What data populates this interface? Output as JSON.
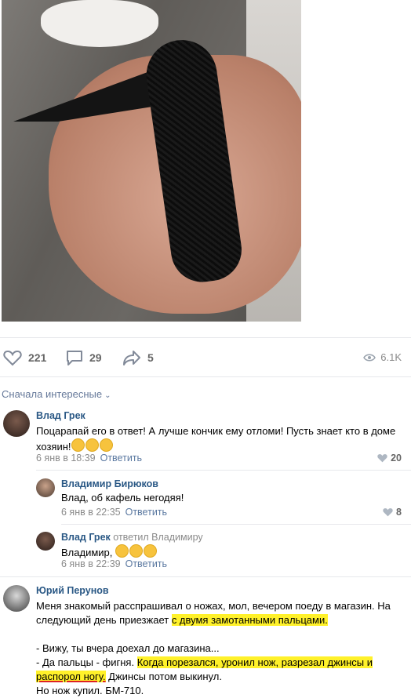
{
  "post": {
    "image_alt": "photo",
    "likes": "221",
    "comments": "29",
    "shares": "5",
    "views": "6.1K"
  },
  "sort_label": "Сначала интересные",
  "comments": [
    {
      "author": "Влад Грек",
      "text": "Поцарапай его в ответ! А лучше кончик ему отломи! Пусть знает кто в доме хозяин!",
      "emoji_count": 3,
      "date": "6 янв в 18:39",
      "reply_label": "Ответить",
      "likes": "20",
      "replies": [
        {
          "author": "Владимир Бирюков",
          "text": "Влад, об кафель негодяя!",
          "date": "6 янв в 22:35",
          "reply_label": "Ответить",
          "likes": "8"
        },
        {
          "author": "Влад Грек",
          "reply_to": "ответил Владимиру",
          "text": "Владимир,",
          "emoji_count": 3,
          "date": "6 янв в 22:39",
          "reply_label": "Ответить"
        }
      ]
    },
    {
      "author": "Юрий Перунов",
      "line1": "Меня знакомый расспрашивал о ножах, мол, вечером поеду в магазин. На",
      "line2a": "следующий день приезжает ",
      "line2b": "с двумя замотанными пальцами.",
      "line3": "- Вижу, ты вчера доехал до магазина...",
      "line4a": "- Да пальцы - фигня. ",
      "line4b": "Когда порезался, уронил нож, разрезал джинсы и",
      "line5a": "распорол ногу.",
      "line5b": " Джинсы потом выкинул.",
      "line6": "Но нож купил. БМ-710."
    }
  ],
  "colors": {
    "link": "#2a5885",
    "highlight": "#fff12a",
    "muted": "#8a8a8a"
  }
}
